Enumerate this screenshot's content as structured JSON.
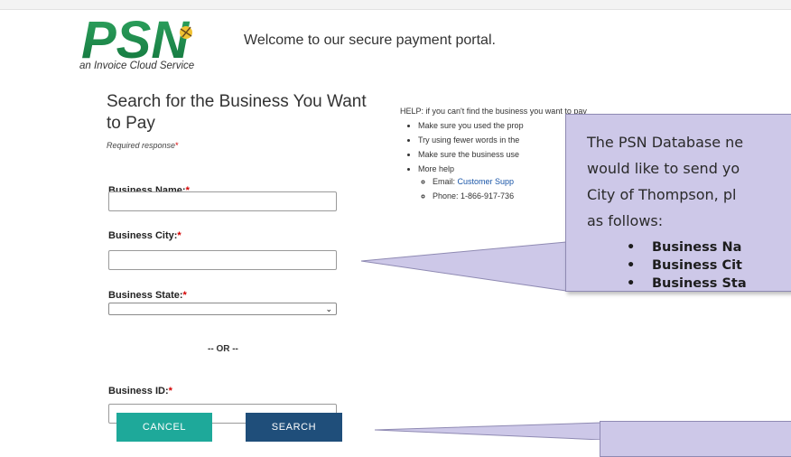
{
  "header": {
    "logo_text": "PSN",
    "logo_tagline": "an Invoice Cloud Service",
    "welcome": "Welcome to our secure payment portal."
  },
  "form": {
    "title": "Search for the Business You Want to Pay",
    "required_note": "Required response",
    "required_mark": "*",
    "business_name_label": "Business Name:",
    "business_city_label": "Business City:",
    "business_state_label": "Business State:",
    "business_state_value": "",
    "or_label": "-- OR --",
    "business_id_label": "Business ID:",
    "cancel_label": "CANCEL",
    "search_label": "SEARCH"
  },
  "help": {
    "title": "HELP: if you can't find the business you want to pay",
    "items": [
      "Make sure you used the prop",
      "Try using fewer words in the",
      "Make sure the business use",
      "More help"
    ],
    "email_label": "Email: ",
    "email_link": "Customer Supp",
    "phone": "Phone: 1-866-917-736"
  },
  "callout": {
    "lines": [
      "The PSN Database ne",
      "would like to send yo",
      "City of Thompson, pl",
      "as follows:"
    ],
    "bullets": [
      "Business Na",
      "Business Cit",
      "Business Sta"
    ]
  },
  "colors": {
    "cancel": "#1ea99a",
    "search": "#1f4e7a",
    "callout_fill": "#cdc8e8",
    "logo_green": "#1e8a4a",
    "required_red": "#d40000"
  }
}
